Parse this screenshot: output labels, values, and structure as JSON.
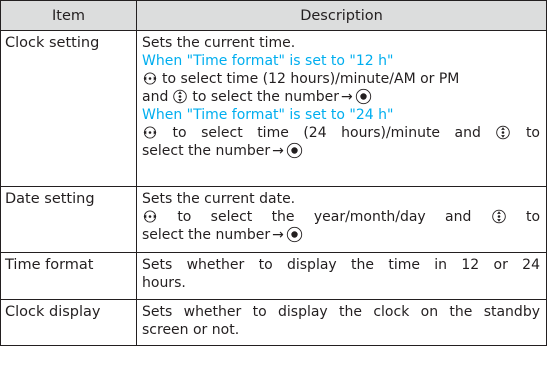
{
  "table": {
    "headers": [
      "Item",
      "Description"
    ],
    "rows": [
      {
        "item": "Clock setting",
        "lines": {
          "l1": "Sets the current time.",
          "h12": "When \"Time format\" is set to \"12 h\"",
          "l2_text": "to select time (12 hours)/minute/AM or PM",
          "l3_pre": "and",
          "l3_mid": "to select the number",
          "h24": "When \"Time format\" is set to \"24 h\"",
          "l4_text": "to select time (24 hours)/minute and",
          "l4_end": "to",
          "l5_text": "select the number"
        }
      },
      {
        "item": "Date setting",
        "lines": {
          "l1": "Sets the current date.",
          "l2_text": "to select the year/month/day and",
          "l2_end": "to",
          "l3_text": "select the number"
        }
      },
      {
        "item": "Time format",
        "lines": {
          "l1": "Sets whether to display the time in 12 or 24",
          "l2": "hours."
        }
      },
      {
        "item": "Clock display",
        "lines": {
          "l1": "Sets whether to display the clock on the standby",
          "l2": "screen or not."
        }
      }
    ],
    "arrow": "→"
  },
  "colors": {
    "heading_condition": "#00aeef",
    "header_background": "#dcdddd",
    "text": "#231f20"
  },
  "icons": {
    "horizontal_key": "nav-left-right-icon",
    "vertical_key": "nav-up-down-icon",
    "center_key": "center-key-icon"
  }
}
